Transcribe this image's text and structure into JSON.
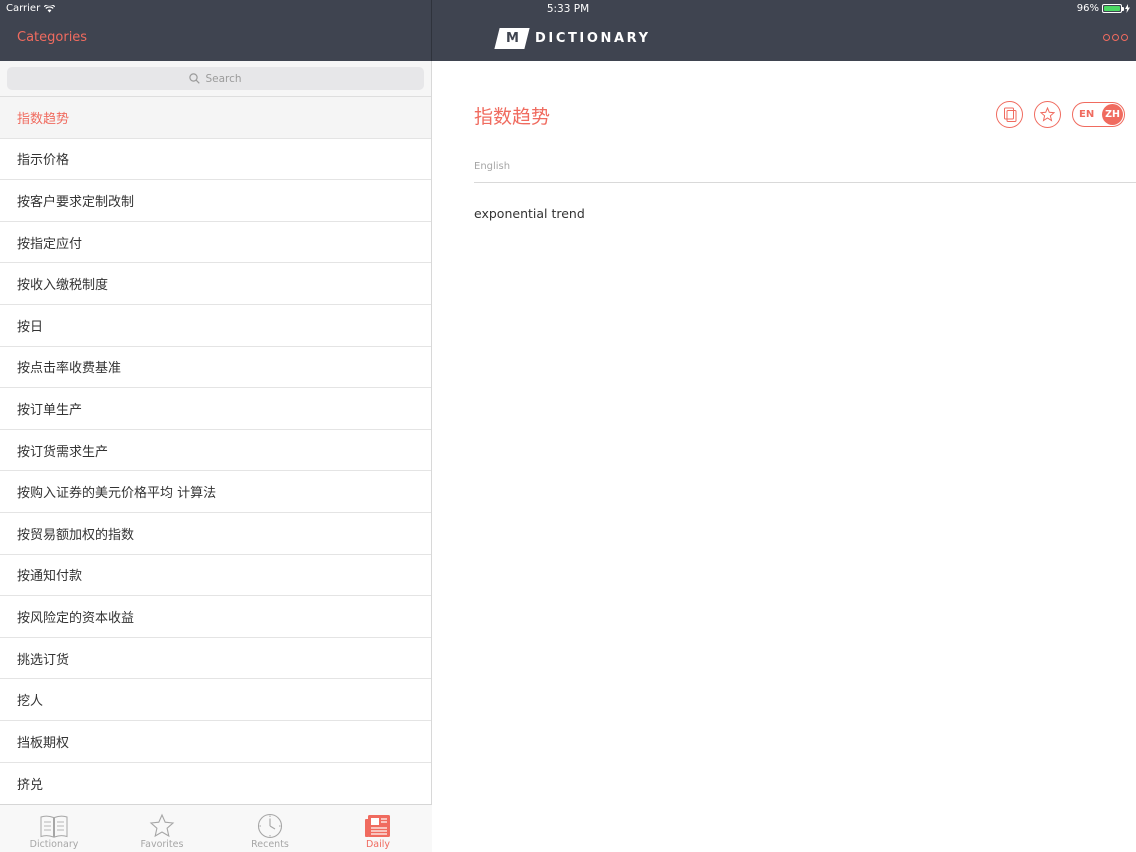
{
  "status": {
    "carrier": "Carrier",
    "time": "5:33 PM",
    "battery": "96%"
  },
  "header": {
    "left_title": "Categories",
    "logo_letter": "M",
    "logo_word": "DICTIONARY"
  },
  "search": {
    "placeholder": "Search"
  },
  "list": {
    "items": [
      "指数趋势",
      "指示价格",
      "按客户要求定制改制",
      "按指定应付",
      "按收入缴税制度",
      "按日",
      "按点击率收费基准",
      "按订单生产",
      "按订货需求生产",
      "按购入证券的美元价格平均 计算法",
      "按贸易额加权的指数",
      "按通知付款",
      "按风险定的资本收益",
      "挑选订货",
      "挖人",
      "挡板期权",
      "挤兑"
    ]
  },
  "tabs": {
    "dictionary": "Dictionary",
    "favorites": "Favorites",
    "recents": "Recents",
    "daily": "Daily"
  },
  "detail": {
    "term": "指数趋势",
    "lang_en": "EN",
    "lang_zh": "ZH",
    "section_label": "English",
    "translation": "exponential trend"
  },
  "colors": {
    "accent": "#f06b5f",
    "header_bg": "#3f4450"
  }
}
